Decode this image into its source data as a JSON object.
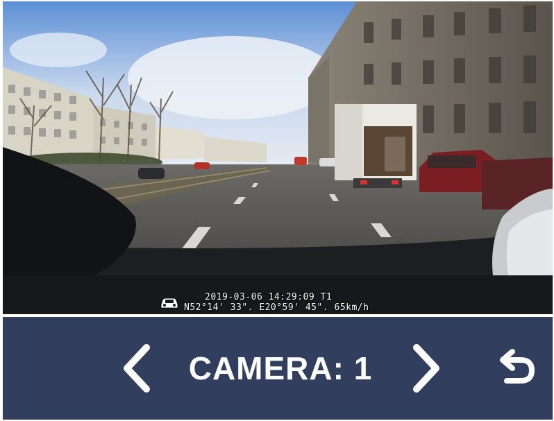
{
  "video": {
    "osd": {
      "line1": "2019-03-06 14:29:09 T1",
      "line2": "N52°14' 33\". E20°59' 45\". 65km/h",
      "icon": "car-icon"
    }
  },
  "controls": {
    "camera_label": "CAMERA: 1",
    "prev_icon": "chevron-left-icon",
    "next_icon": "chevron-right-icon",
    "back_icon": "return-arrow-icon",
    "bar_color": "#323e5d"
  }
}
